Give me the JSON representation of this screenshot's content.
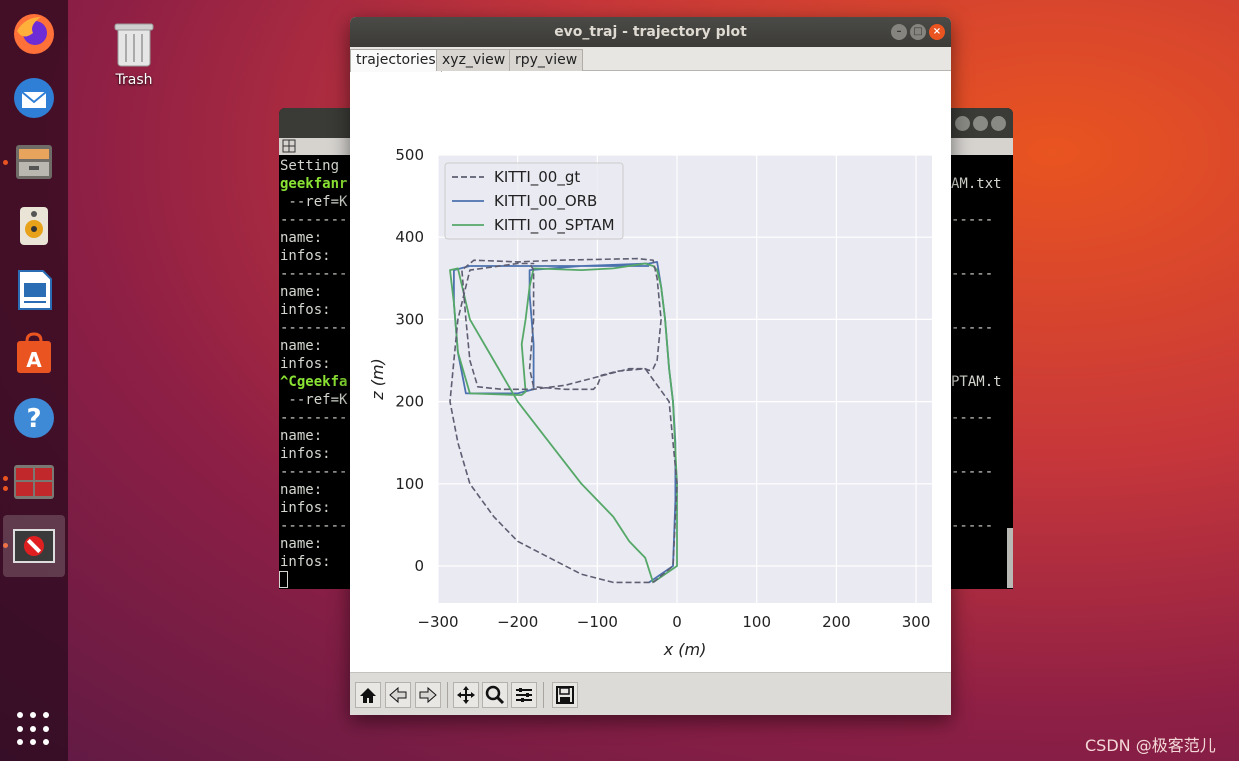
{
  "desktop": {
    "trash_label": "Trash",
    "watermark": "CSDN @极客范儿"
  },
  "dock": {
    "items": [
      "firefox-icon",
      "thunderbird-icon",
      "files-icon",
      "rhythmbox-icon",
      "writer-icon",
      "software-icon",
      "help-icon",
      "terminal-icon",
      "figure-window-icon"
    ]
  },
  "terminal": {
    "lines": [
      {
        "text": "Setting",
        "green": false
      },
      {
        "text": "geekfanr",
        "green": true
      },
      {
        "text": " --ref=K",
        "green": false
      },
      {
        "text": "--------",
        "green": false
      },
      {
        "text": "name:",
        "green": false
      },
      {
        "text": "infos:",
        "green": false
      },
      {
        "text": "--------",
        "green": false
      },
      {
        "text": "name:",
        "green": false
      },
      {
        "text": "infos:",
        "green": false
      },
      {
        "text": "--------",
        "green": false
      },
      {
        "text": "name:",
        "green": false
      },
      {
        "text": "infos:",
        "green": false
      },
      {
        "text": "^Cgeekfa",
        "green": true
      },
      {
        "text": " --ref=K",
        "green": false
      },
      {
        "text": "--------",
        "green": false
      },
      {
        "text": "name:",
        "green": false
      },
      {
        "text": "infos:",
        "green": false
      },
      {
        "text": "--------",
        "green": false
      },
      {
        "text": "name:",
        "green": false
      },
      {
        "text": "infos:",
        "green": false
      },
      {
        "text": "--------",
        "green": false
      },
      {
        "text": "name:",
        "green": false
      },
      {
        "text": "infos:",
        "green": false
      }
    ],
    "right_fragments": [
      "AM.txt",
      "-----",
      "-----",
      "-----",
      "PTAM.t",
      "-----",
      "-----",
      "-----"
    ]
  },
  "window": {
    "title": "evo_traj - trajectory plot",
    "tabs": [
      {
        "label": "trajectories",
        "active": true
      },
      {
        "label": "xyz_view",
        "active": false
      },
      {
        "label": "rpy_view",
        "active": false
      }
    ],
    "toolbar": [
      "home-icon",
      "back-icon",
      "forward-icon",
      "pan-icon",
      "zoom-icon",
      "configure-icon",
      "save-icon"
    ]
  },
  "chart_data": {
    "type": "line",
    "xlabel": "x (m)",
    "ylabel": "z (m)",
    "xlim": [
      -300,
      320
    ],
    "ylim": [
      -45,
      500
    ],
    "xticks": [
      -300,
      -200,
      -100,
      0,
      100,
      200,
      300
    ],
    "xtick_labels": [
      "−300",
      "−200",
      "−100",
      "0",
      "100",
      "200",
      "300"
    ],
    "yticks": [
      0,
      100,
      200,
      300,
      400,
      500
    ],
    "grid": true,
    "legend_position": "top-left",
    "series": [
      {
        "name": "KITTI_00_gt",
        "color": "#5e5e73",
        "dash": true,
        "x": [
          -30,
          -5,
          0,
          -10,
          -40,
          -60,
          -100,
          -140,
          -180,
          -220,
          -250,
          -260,
          -265,
          -270,
          -255,
          -200,
          -150,
          -100,
          -50,
          -30,
          -25,
          -20,
          -25,
          -30,
          -30,
          -35,
          -40,
          -75,
          -95,
          -100,
          -105,
          -140,
          -180,
          -185,
          -180,
          -180,
          -180,
          -185,
          -180,
          -200,
          -260,
          -275,
          -280,
          -285,
          -275,
          -260,
          -230,
          -200,
          -160,
          -120,
          -80,
          -60,
          -40,
          -30
        ],
        "y": [
          -20,
          0,
          100,
          200,
          240,
          240,
          230,
          220,
          215,
          215,
          218,
          250,
          300,
          360,
          372,
          370,
          372,
          373,
          374,
          372,
          350,
          300,
          250,
          240,
          240,
          238,
          240,
          237,
          232,
          220,
          215,
          215,
          218,
          240,
          300,
          330,
          360,
          368,
          368,
          368,
          360,
          300,
          250,
          200,
          150,
          100,
          60,
          30,
          10,
          -10,
          -20,
          -20,
          -20,
          -20
        ]
      },
      {
        "name": "KITTI_00_ORB",
        "color": "#4c72b0",
        "dash": false,
        "x": [
          -35,
          -5,
          -2,
          -2,
          -5,
          -10,
          -15,
          -20,
          -25,
          -35,
          -120,
          -185,
          -185,
          -180,
          -180,
          -200,
          -265,
          -275,
          -280,
          -280,
          -260,
          -230,
          -180,
          -120,
          -70,
          -35
        ],
        "y": [
          -20,
          0,
          80,
          150,
          200,
          240,
          300,
          340,
          370,
          368,
          365,
          360,
          330,
          270,
          215,
          210,
          210,
          260,
          320,
          360,
          365,
          365,
          365,
          365,
          365,
          365
        ]
      },
      {
        "name": "KITTI_00_SPTAM",
        "color": "#55a868",
        "dash": false,
        "x": [
          -30,
          0,
          0,
          -5,
          -10,
          -15,
          -20,
          -25,
          -30,
          -40,
          -80,
          -120,
          -180,
          -185,
          -190,
          -195,
          -190,
          -195,
          -200,
          -260,
          -275,
          -280,
          -285,
          -275,
          -260,
          -230,
          -200,
          -160,
          -120,
          -80,
          -60,
          -40,
          -30
        ],
        "y": [
          -20,
          0,
          100,
          200,
          240,
          300,
          340,
          360,
          365,
          368,
          362,
          360,
          362,
          340,
          300,
          270,
          212,
          208,
          208,
          210,
          260,
          320,
          360,
          362,
          300,
          250,
          200,
          150,
          100,
          60,
          30,
          10,
          -20
        ]
      }
    ]
  }
}
